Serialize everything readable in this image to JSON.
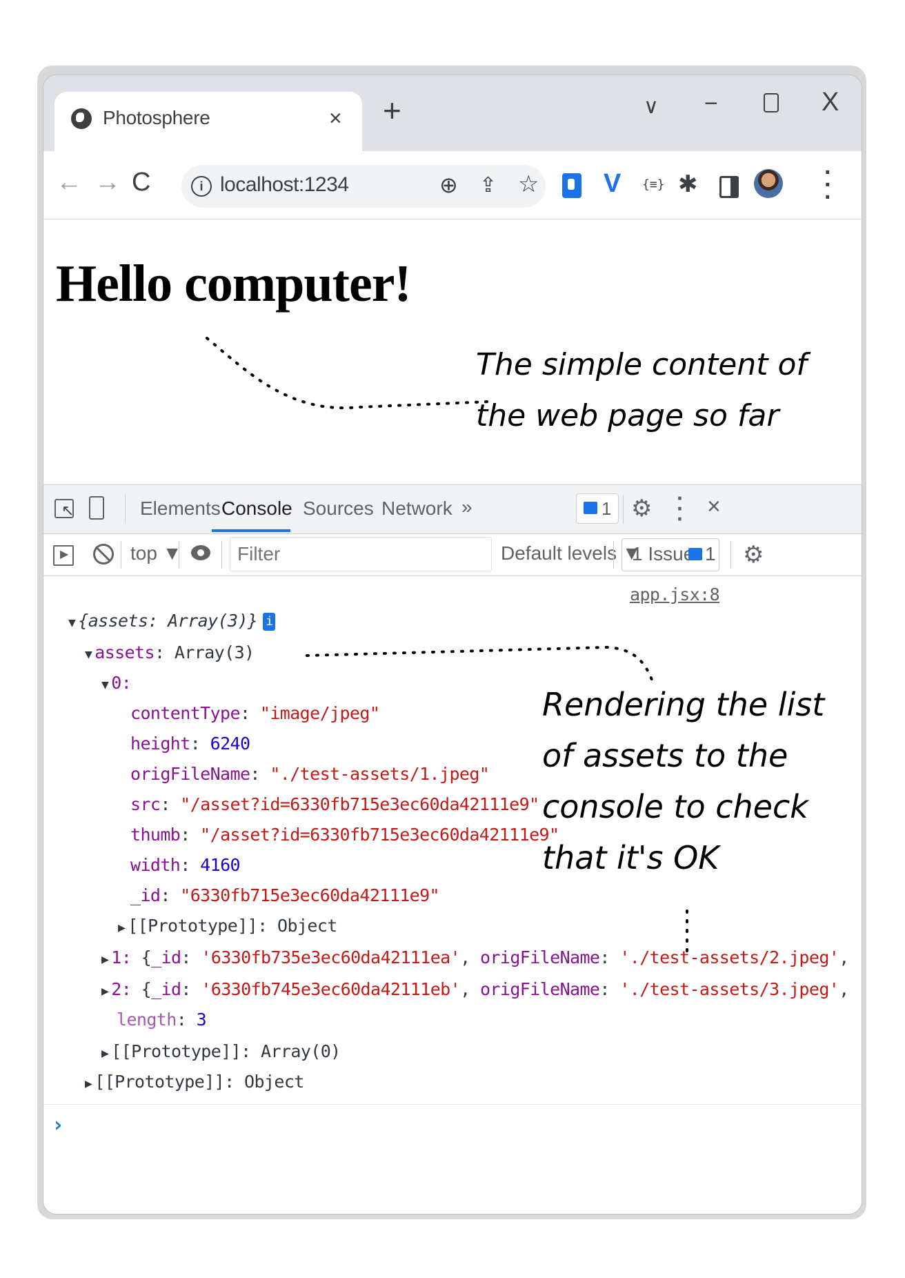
{
  "browser": {
    "tab_title": "Photosphere",
    "tab_close": "×",
    "new_tab": "+",
    "url": "localhost:1234",
    "nav": {
      "back": "←",
      "forward": "→",
      "reload": "C"
    },
    "window_controls": {
      "menu": "∨",
      "minimize": "−",
      "close": "X"
    }
  },
  "page": {
    "heading": "Hello computer!"
  },
  "annotations": {
    "note1_line1": "The simple content of",
    "note1_line2": "the web page so far",
    "note2_line1": "Rendering the list",
    "note2_line2": "of assets to the",
    "note2_line3": "console to check",
    "note2_line4": "that it's OK"
  },
  "devtools": {
    "tabs": [
      "Elements",
      "Console",
      "Sources",
      "Network"
    ],
    "active_tab": "Console",
    "more_tabs": "»",
    "message_count": "1",
    "context": "top ▼",
    "filter_placeholder": "Filter",
    "levels": "Default levels ▼",
    "issues_label": "1 Issue:",
    "issues_count": "1",
    "source_link": "app.jsx:8",
    "prompt": "›"
  },
  "console": {
    "root_preview": "{assets: Array(3)}",
    "info_badge": "i",
    "assets_key": "assets",
    "assets_preview": "Array(3)",
    "item0_key": "0:",
    "item0": {
      "contentType": "\"image/jpeg\"",
      "height": "6240",
      "origFileName": "\"./test-assets/1.jpeg\"",
      "src": "\"/asset?id=6330fb715e3ec60da42111e9\"",
      "thumb": "\"/asset?id=6330fb715e3ec60da42111e9\"",
      "width": "4160",
      "_id": "\"6330fb715e3ec60da42111e9\""
    },
    "item0_proto": "[[Prototype]]: Object",
    "item1_key": "1:",
    "item1_id": "'6330fb735e3ec60da42111ea'",
    "item1_file": "'./test-assets/2.jpeg'",
    "item2_key": "2:",
    "item2_id": "'6330fb745e3ec60da42111eb'",
    "item2_file": "'./test-assets/3.jpeg'",
    "length_key": "length",
    "length_value": "3",
    "array_proto": "[[Prototype]]: Array(0)",
    "object_proto": "[[Prototype]]: Object"
  }
}
